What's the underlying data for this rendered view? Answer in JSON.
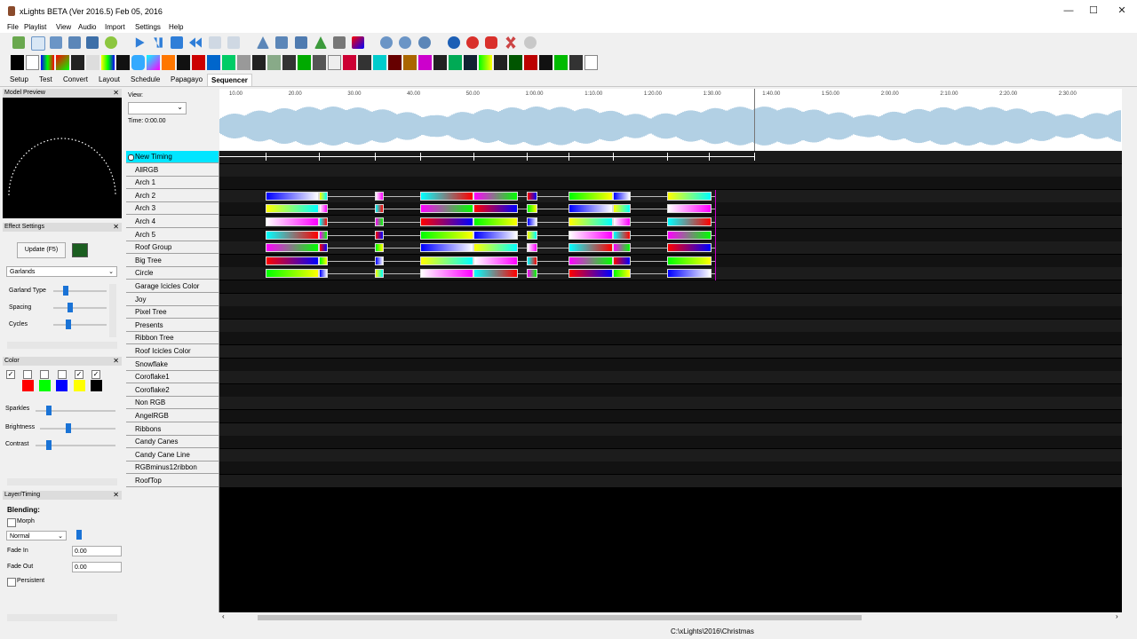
{
  "window": {
    "title": "xLights BETA (Ver 2016.5) Feb 05, 2016",
    "minimize": "—",
    "maximize": "☐",
    "close": "✕"
  },
  "menu": [
    "File",
    "Playlist",
    "View",
    "Audio",
    "Import",
    "Settings",
    "Help"
  ],
  "tabs": [
    "Setup",
    "Test",
    "Convert",
    "Layout",
    "Schedule",
    "Papagayo",
    "Sequencer"
  ],
  "active_tab": "Sequencer",
  "panels": {
    "model_preview": {
      "title": "Model Preview"
    },
    "effect_settings": {
      "title": "Effect Settings",
      "update_button": "Update (F5)",
      "effect_select": "Garlands",
      "sliders": [
        "Garland Type",
        "Spacing",
        "Cycles"
      ]
    },
    "color": {
      "title": "Color",
      "sliders": [
        "Sparkles",
        "Brightness",
        "Contrast"
      ],
      "palette": [
        "#ff0000",
        "#00ff00",
        "#0000ff",
        "#ffff00",
        "#000000"
      ]
    },
    "layer_timing": {
      "title": "Layer/Timing",
      "blending_label": "Blending:",
      "morph_label": "Morph",
      "mode": "Normal",
      "fade_in_label": "Fade In",
      "fade_in_value": "0.00",
      "fade_out_label": "Fade Out",
      "fade_out_value": "0.00",
      "persistent_label": "Persistent"
    }
  },
  "view": {
    "label": "View:",
    "time_label": "Time: 0:00.00"
  },
  "ruler": [
    "10.00",
    "20.00",
    "30.00",
    "40.00",
    "50.00",
    "1:00.00",
    "1:10.00",
    "1:20.00",
    "1:30.00",
    "1:40.00",
    "1:50.00",
    "2:00.00",
    "2:10.00",
    "2:20.00",
    "2:30.00"
  ],
  "timing_track": "New Timing",
  "models": [
    "AllRGB",
    "Arch 1",
    "Arch 2",
    "Arch 3",
    "Arch 4",
    "Arch 5",
    "Roof Group",
    "Big Tree",
    "Circle",
    "Garage Icicles Color",
    "Joy",
    "Pixel Tree",
    "Presents",
    "Ribbon Tree",
    "Roof Icicles Color",
    "Snowflake",
    "Coroflake1",
    "Coroflake2",
    "Non RGB",
    "AngelRGB",
    "Ribbons",
    "Candy Canes",
    "Candy Cane Line",
    "RGBminus12ribbon",
    "RoofTop"
  ],
  "status": {
    "path": "C:\\xLights\\2016\\Christmas"
  },
  "colors": {
    "timing_highlight": "#00e5ff",
    "waveform": "#9fc4de",
    "accent": "#1a73d6"
  }
}
